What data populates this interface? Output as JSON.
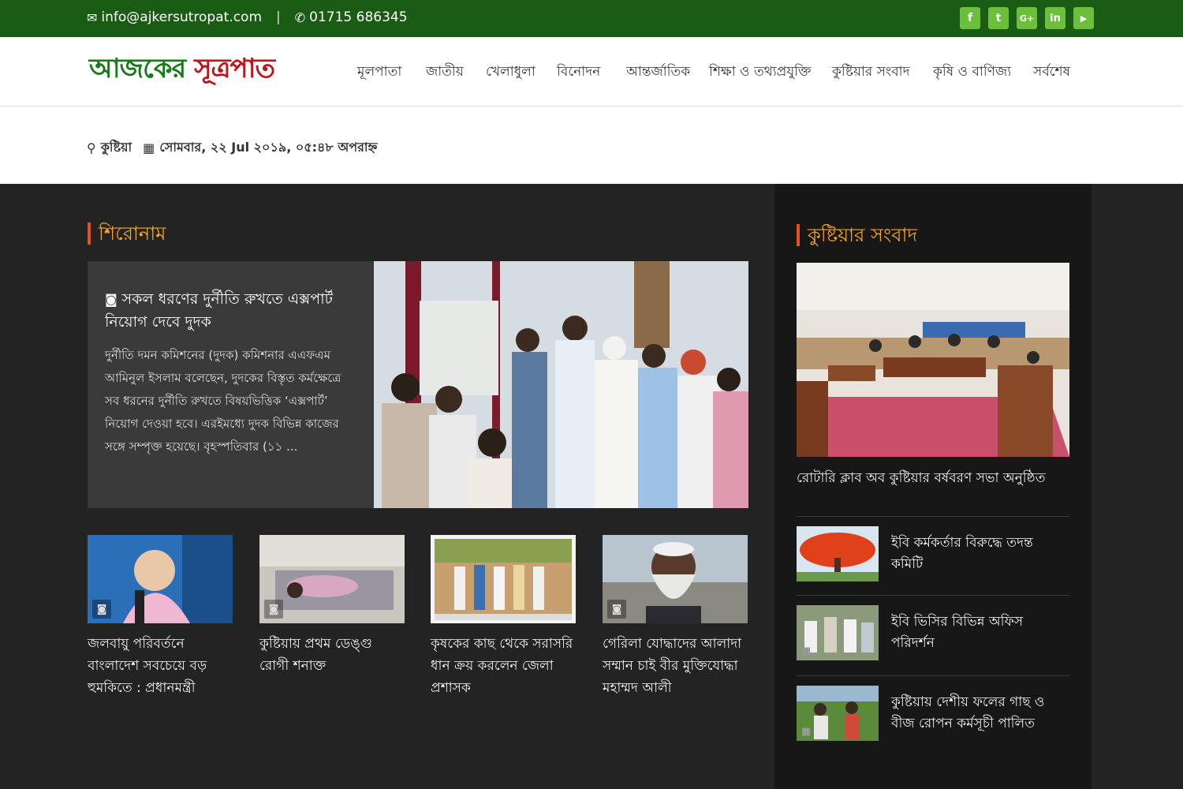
{
  "topbar": {
    "email": "info@ajkersutropat.com",
    "separator": "|",
    "phone": "01715 686345",
    "social": [
      "f",
      "t",
      "G+",
      "in",
      "▶"
    ],
    "social_icons": [
      "facebook-icon",
      "twitter-icon",
      "google-plus-icon",
      "linkedin-icon",
      "youtube-icon"
    ]
  },
  "header": {
    "logo_part1": "আজকের",
    "logo_part2": "সূত্রপাত",
    "nav": [
      "মূলপাতা",
      "জাতীয়",
      "খেলাধুলা",
      "বিনোদন",
      "আন্তর্জাতিক",
      "শিক্ষা ও তথ্যপ্রযুক্তি",
      "কুষ্টিয়ার সংবাদ",
      "কৃষি ও বাণিজ্য",
      "সর্বশেষ"
    ]
  },
  "datebar": {
    "location": "কুষ্টিয়া",
    "datetime": "সোমবার, ২২ Jul ২০১৯, ০৫:৪৮ অপরাহ্ন"
  },
  "headlines": {
    "section_title": "শিরোনাম",
    "lead": {
      "title": "সকল ধরণের দুর্নীতি রুখতে এক্সপার্ট নিয়োগ দেবে দুদক",
      "summary": "দুর্নীতি দমন কমিশনের (দুদক) কমিশনার এএফএম আমিনুল ইসলাম বলেছেন, দুদকের বিস্তৃত কর্মক্ষেত্রে সব ধরনের দুর্নীতি রুখতে বিষয়ভিত্তিক ‘এক্সপার্ট’ নিয়োগ দেওয়া হবে। এরইমধ্যে দুদক বিভিন্ন কাজের সঙ্গে সম্পৃক্ত হয়েছে। বৃহস্পতিবার (১১ ..."
    },
    "cards": [
      {
        "title": "জলবায়ু পরিবর্তনে বাংলাদেশ সবচেয়ে বড় হুমকিতে : প্রধানমন্ত্রী"
      },
      {
        "title": "কুষ্টিয়ায় প্রথম ডেঙ্গু রোগী শনাক্ত"
      },
      {
        "title": "কৃষকের কাছ থেকে সরাসরি ধান ক্রয় করলেন জেলা প্রশাসক"
      },
      {
        "title": "গেরিলা যোদ্ধাদের আলাদা সম্মান চাই বীর মুক্তিযোদ্ধা মহাম্মদ আলী"
      }
    ]
  },
  "kushtia": {
    "section_title": "কুষ্টিয়ার সংবাদ",
    "lead_title": "রোটারি ক্লাব অব কুষ্টিয়ার বর্ষবরণ সভা অনুষ্ঠিত",
    "items": [
      {
        "title": "ইবি কর্মকর্তার বিরুদ্ধে তদন্ত কমিটি"
      },
      {
        "title": "ইবি ভিসির বিভিন্ন অফিস পরিদর্শন"
      },
      {
        "title": "কুষ্টিয়ায় দেশীয় ফলের গাছ ও বীজ রোপন কর্মসূচী পালিত"
      }
    ]
  }
}
